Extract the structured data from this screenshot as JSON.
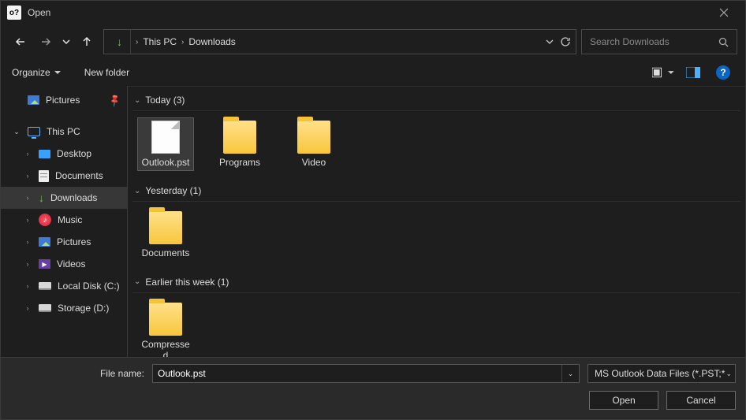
{
  "title": "Open",
  "breadcrumb": {
    "root": "This PC",
    "current": "Downloads"
  },
  "search": {
    "placeholder": "Search Downloads"
  },
  "toolbar": {
    "organize": "Organize",
    "new_folder": "New folder"
  },
  "sidebar": {
    "pictures_quick": "Pictures",
    "this_pc": "This PC",
    "items": [
      {
        "label": "Desktop"
      },
      {
        "label": "Documents"
      },
      {
        "label": "Downloads"
      },
      {
        "label": "Music"
      },
      {
        "label": "Pictures"
      },
      {
        "label": "Videos"
      },
      {
        "label": "Local Disk (C:)"
      },
      {
        "label": "Storage (D:)"
      }
    ]
  },
  "groups": [
    {
      "header": "Today (3)",
      "items": [
        {
          "name": "Outlook.pst",
          "type": "file",
          "selected": true
        },
        {
          "name": "Programs",
          "type": "folder"
        },
        {
          "name": "Video",
          "type": "folder"
        }
      ]
    },
    {
      "header": "Yesterday (1)",
      "items": [
        {
          "name": "Documents",
          "type": "folder"
        }
      ]
    },
    {
      "header": "Earlier this week (1)",
      "items": [
        {
          "name": "Compressed",
          "type": "folder"
        }
      ]
    }
  ],
  "footer": {
    "filename_label": "File name:",
    "filename_value": "Outlook.pst",
    "filter_label": "MS Outlook Data Files (*.PST;*.OST)",
    "open": "Open",
    "cancel": "Cancel"
  }
}
